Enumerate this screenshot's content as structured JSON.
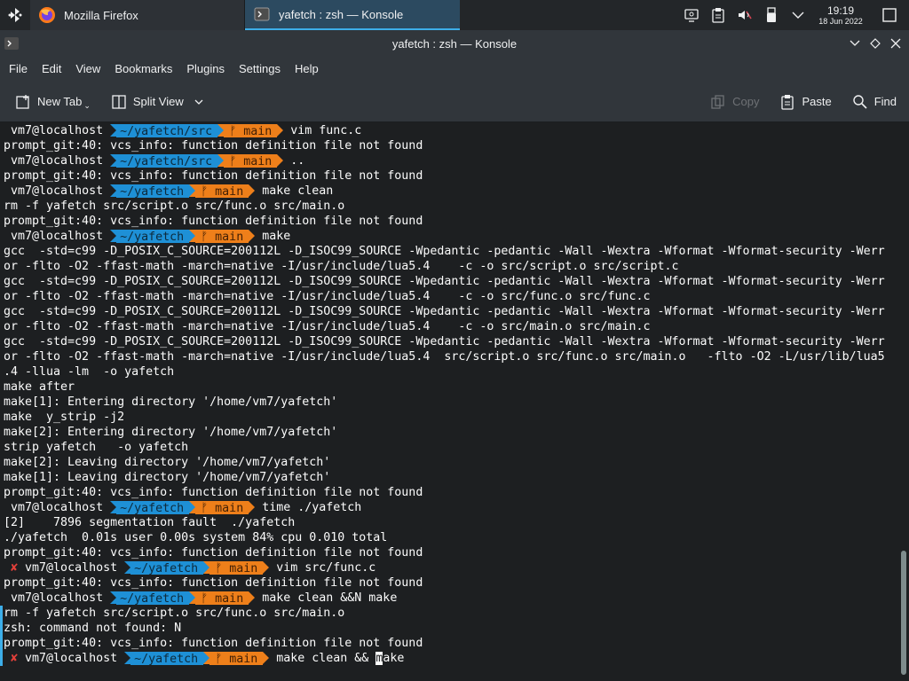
{
  "taskbar": {
    "tasks": [
      {
        "label": "Mozilla Firefox",
        "icon": "firefox-icon"
      },
      {
        "label": "yafetch : zsh — Konsole",
        "icon": "konsole-icon"
      }
    ],
    "clock": {
      "time": "19:19",
      "date": "18 Jun 2022"
    }
  },
  "window": {
    "title": "yafetch : zsh — Konsole"
  },
  "menubar": {
    "items": [
      "File",
      "Edit",
      "View",
      "Bookmarks",
      "Plugins",
      "Settings",
      "Help"
    ]
  },
  "toolbar": {
    "new_tab": "New Tab",
    "split_view": "Split View",
    "copy": "Copy",
    "paste": "Paste",
    "find": "Find"
  },
  "prompt": {
    "host": "vm7@localhost",
    "branch": "main",
    "branch_icon": "ᚠ",
    "fail_mark": "✘"
  },
  "colors": {
    "dir_segment": "#1e90d6",
    "git_segment": "#ee7f1a",
    "accent": "#3daee9",
    "error": "#e3403a"
  },
  "terminal": {
    "lines": [
      {
        "type": "prompt",
        "dir": "~/yafetch/src",
        "cmd": "vim func.c"
      },
      {
        "type": "text",
        "text": "prompt_git:40: vcs_info: function definition file not found"
      },
      {
        "type": "prompt",
        "dir": "~/yafetch/src",
        "cmd": ".."
      },
      {
        "type": "text",
        "text": "prompt_git:40: vcs_info: function definition file not found"
      },
      {
        "type": "prompt",
        "dir": "~/yafetch",
        "cmd": "make clean"
      },
      {
        "type": "text",
        "text": "rm -f yafetch src/script.o src/func.o src/main.o"
      },
      {
        "type": "text",
        "text": "prompt_git:40: vcs_info: function definition file not found"
      },
      {
        "type": "prompt",
        "dir": "~/yafetch",
        "cmd": "make"
      },
      {
        "type": "text",
        "text": "gcc  -std=c99 -D_POSIX_C_SOURCE=200112L -D_ISOC99_SOURCE -Wpedantic -pedantic -Wall -Wextra -Wformat -Wformat-security -Werr"
      },
      {
        "type": "text",
        "text": "or -flto -O2 -ffast-math -march=native -I/usr/include/lua5.4    -c -o src/script.o src/script.c"
      },
      {
        "type": "text",
        "text": "gcc  -std=c99 -D_POSIX_C_SOURCE=200112L -D_ISOC99_SOURCE -Wpedantic -pedantic -Wall -Wextra -Wformat -Wformat-security -Werr"
      },
      {
        "type": "text",
        "text": "or -flto -O2 -ffast-math -march=native -I/usr/include/lua5.4    -c -o src/func.o src/func.c"
      },
      {
        "type": "text",
        "text": "gcc  -std=c99 -D_POSIX_C_SOURCE=200112L -D_ISOC99_SOURCE -Wpedantic -pedantic -Wall -Wextra -Wformat -Wformat-security -Werr"
      },
      {
        "type": "text",
        "text": "or -flto -O2 -ffast-math -march=native -I/usr/include/lua5.4    -c -o src/main.o src/main.c"
      },
      {
        "type": "text",
        "text": "gcc  -std=c99 -D_POSIX_C_SOURCE=200112L -D_ISOC99_SOURCE -Wpedantic -pedantic -Wall -Wextra -Wformat -Wformat-security -Werr"
      },
      {
        "type": "text",
        "text": "or -flto -O2 -ffast-math -march=native -I/usr/include/lua5.4  src/script.o src/func.o src/main.o   -flto -O2 -L/usr/lib/lua5"
      },
      {
        "type": "text",
        "text": ".4 -llua -lm  -o yafetch"
      },
      {
        "type": "text",
        "text": "make after"
      },
      {
        "type": "text",
        "text": "make[1]: Entering directory '/home/vm7/yafetch'"
      },
      {
        "type": "text",
        "text": "make  y_strip -j2"
      },
      {
        "type": "text",
        "text": "make[2]: Entering directory '/home/vm7/yafetch'"
      },
      {
        "type": "text",
        "text": "strip yafetch   -o yafetch"
      },
      {
        "type": "text",
        "text": "make[2]: Leaving directory '/home/vm7/yafetch'"
      },
      {
        "type": "text",
        "text": "make[1]: Leaving directory '/home/vm7/yafetch'"
      },
      {
        "type": "text",
        "text": "prompt_git:40: vcs_info: function definition file not found"
      },
      {
        "type": "prompt",
        "dir": "~/yafetch",
        "cmd": "time ./yafetch"
      },
      {
        "type": "text",
        "text": "[2]    7896 segmentation fault  ./yafetch"
      },
      {
        "type": "text",
        "text": "./yafetch  0.01s user 0.00s system 84% cpu 0.010 total"
      },
      {
        "type": "text",
        "text": "prompt_git:40: vcs_info: function definition file not found"
      },
      {
        "type": "prompt",
        "dir": "~/yafetch",
        "cmd": "vim src/func.c",
        "failed": true
      },
      {
        "type": "text",
        "text": "prompt_git:40: vcs_info: function definition file not found"
      },
      {
        "type": "prompt",
        "dir": "~/yafetch",
        "cmd": "make clean &&N make"
      },
      {
        "type": "text",
        "text": "rm -f yafetch src/script.o src/func.o src/main.o",
        "marked": true
      },
      {
        "type": "text",
        "text": "zsh: command not found: N",
        "marked": true
      },
      {
        "type": "text",
        "text": "prompt_git:40: vcs_info: function definition file not found",
        "marked": true
      },
      {
        "type": "prompt",
        "dir": "~/yafetch",
        "cmd": "make clean && ",
        "cursor_char": "m",
        "cmd_rest": "ake",
        "failed": true,
        "marked": true
      }
    ]
  }
}
